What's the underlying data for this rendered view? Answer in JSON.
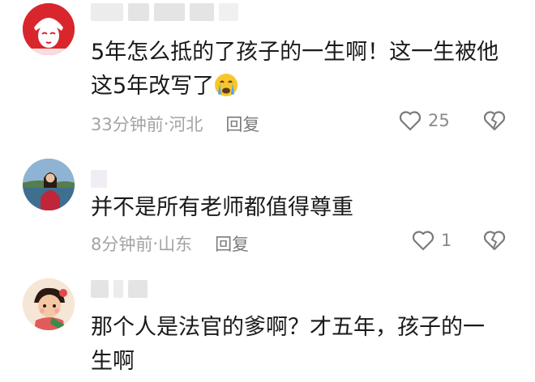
{
  "comments": [
    {
      "text": "5年怎么抵的了孩子的一生啊！这一生被他这5年改写了",
      "emoji": "crying-face",
      "time": "33分钟前",
      "location": "河北",
      "reply_label": "回复",
      "likes": "25"
    },
    {
      "text": "并不是所有老师都值得尊重",
      "time": "8分钟前",
      "location": "山东",
      "reply_label": "回复",
      "likes": "1"
    },
    {
      "text": "那个人是法官的爹啊？才五年，孩子的一生啊"
    }
  ],
  "meta_separator": " · ",
  "colors": {
    "text": "#1a1a1a",
    "meta": "#a3a3a3",
    "avatar1_bg": "#d9262c"
  }
}
